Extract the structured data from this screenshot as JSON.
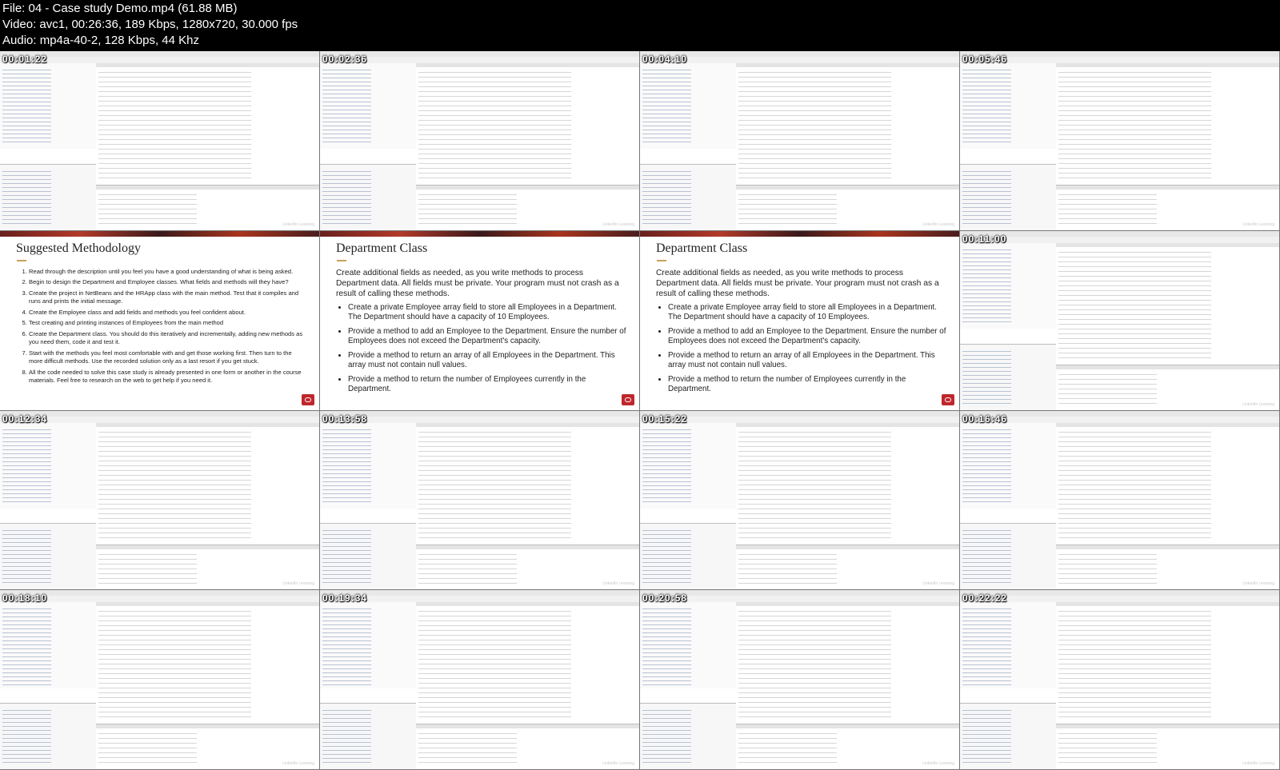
{
  "header": {
    "file_line": "File: 04 - Case study Demo.mp4 (61.88 MB)",
    "video_line": "Video: avc1, 00:26:36, 189 Kbps, 1280x720, 30.000 fps",
    "audio_line": "Audio: mp4a-40-2, 128 Kbps, 44 Khz"
  },
  "thumbnails": [
    {
      "timestamp": "00:01:22",
      "kind": "ide"
    },
    {
      "timestamp": "00:02:36",
      "kind": "ide"
    },
    {
      "timestamp": "00:04:10",
      "kind": "ide"
    },
    {
      "timestamp": "00:05:46",
      "kind": "ide"
    },
    {
      "timestamp": "",
      "kind": "slide-methodology"
    },
    {
      "timestamp": "",
      "kind": "slide-department"
    },
    {
      "timestamp": "",
      "kind": "slide-department"
    },
    {
      "timestamp": "00:11:00",
      "kind": "ide"
    },
    {
      "timestamp": "00:12:34",
      "kind": "ide"
    },
    {
      "timestamp": "00:13:58",
      "kind": "ide"
    },
    {
      "timestamp": "00:15:22",
      "kind": "ide"
    },
    {
      "timestamp": "00:16:46",
      "kind": "ide"
    },
    {
      "timestamp": "00:18:10",
      "kind": "ide"
    },
    {
      "timestamp": "00:19:34",
      "kind": "ide"
    },
    {
      "timestamp": "00:20:58",
      "kind": "ide"
    },
    {
      "timestamp": "00:22:22",
      "kind": "ide"
    }
  ],
  "slide_methodology": {
    "title": "Suggested Methodology",
    "items": [
      "Read through the description until you feel you have a good understanding of what is being asked.",
      "Begin to design the Department and Employee classes. What fields and methods will they have?",
      "Create the project in NetBeans and the HRApp class with the main method. Test that it compiles and runs and prints the initial message.",
      "Create the Employee class and add fields and methods you feel confident about.",
      "Test creating and printing instances of Employees from the main method",
      "Create the Department class. You should do this iteratively and incrementally, adding new methods as you need them, code it and test it.",
      "Start with the methods you feel most comfortable with and get those working first. Then turn to the more difficult methods. Use the recorded solution only as a last resort if you get stuck.",
      "All the code needed to solve this case study is already presented in one form or another in the course materials. Feel free to research on the web to get help if you need it."
    ]
  },
  "slide_department": {
    "title": "Department Class",
    "intro": "Create additional fields as needed, as you write methods to process Department data. All fields must be private. Your program must not crash as a result of calling these methods.",
    "bullets": [
      "Create a private Employee array field to store all Employees in a Department. The Department should have a capacity of 10 Employees.",
      "Provide a method to add an Employee to the Department. Ensure the number of Employees does not exceed the Department's capacity.",
      "Provide a method to return an array of all Employees in the Department. This array must not contain null values.",
      "Provide a method to return the number of Employees currently in the Department."
    ]
  },
  "ide_brand": "LinkedIn Learning"
}
